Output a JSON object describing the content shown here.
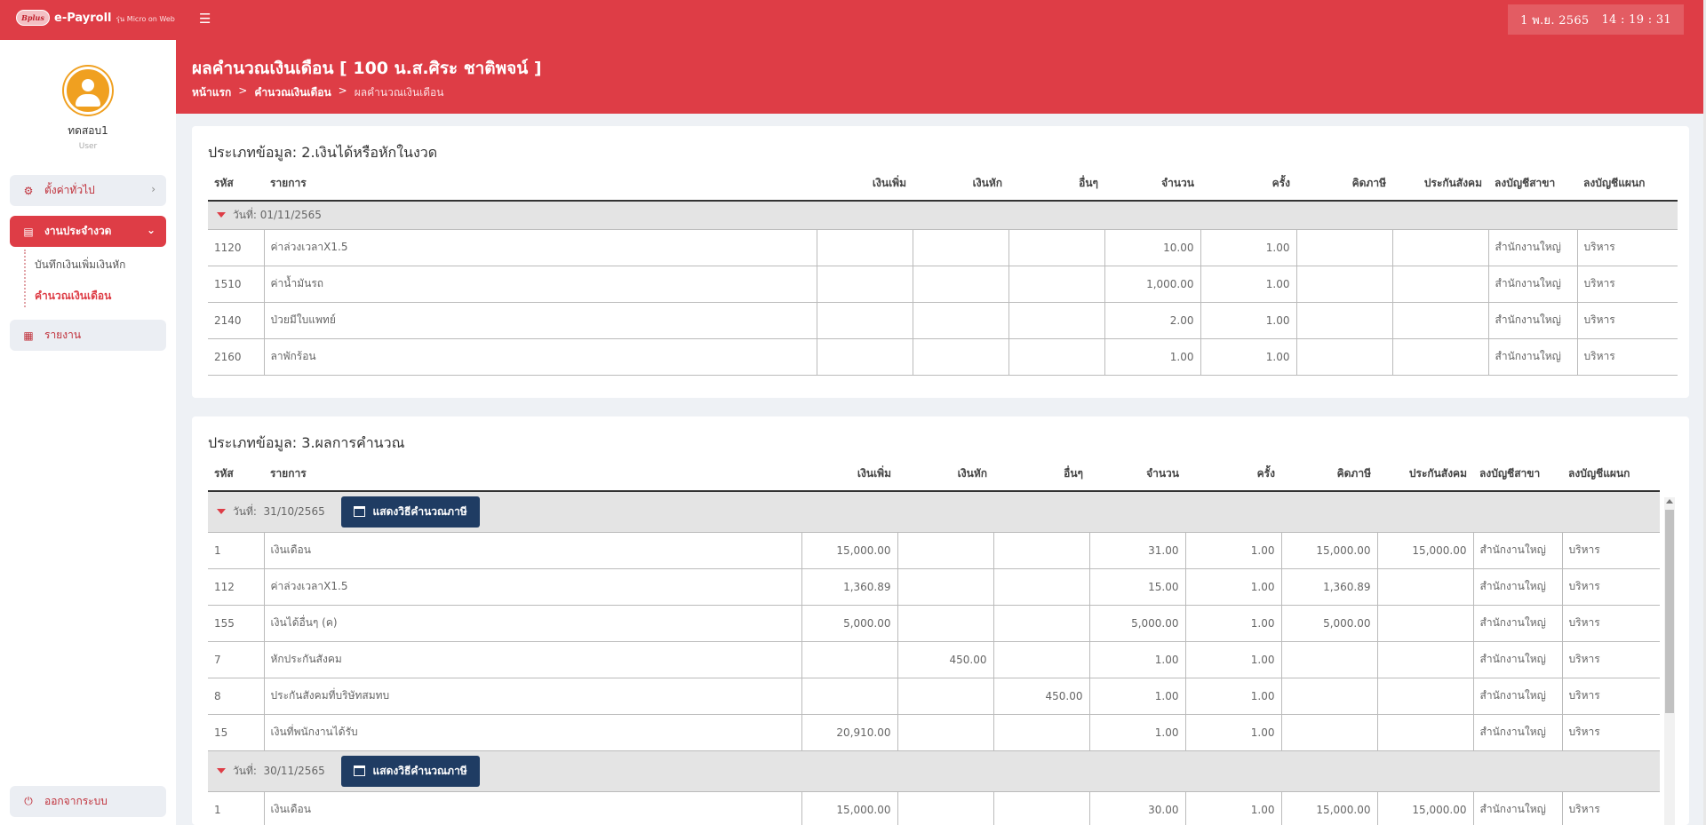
{
  "app": {
    "logo_text": "Bplus",
    "title": "e-Payroll",
    "subtitle": "รุ่น Micro on Web",
    "date": "1 พ.ย. 2565",
    "time": "14 : 19 : 31"
  },
  "user": {
    "name": "ทดสอบ1",
    "role": "User"
  },
  "sidebar": {
    "general_settings": "ตั้งค่าทั่วไป",
    "period_work": "งานประจำงวด",
    "sub_record": "บันทึกเงินเพิ่มเงินหัก",
    "sub_calculate": "คำนวณเงินเดือน",
    "reports": "รายงาน",
    "logout": "ออกจากระบบ"
  },
  "header": {
    "title": "ผลคำนวณเงินเดือน [ 100 น.ส.ศิระ ชาติพจน์ ]",
    "breadcrumb": [
      "หน้าแรก",
      ">",
      "คำนวณเงินเดือน",
      ">",
      "ผลคำนวณเงินเดือน"
    ]
  },
  "columns": [
    "รหัส",
    "รายการ",
    "เงินเพิ่ม",
    "เงินหัก",
    "อื่นๆ",
    "จำนวน",
    "ครั้ง",
    "คิดภาษี",
    "ประกันสังคม",
    "ลงบัญชีสาขา",
    "ลงบัญชีแผนก"
  ],
  "section2": {
    "title": "ประเภทข้อมูล: 2.เงินได้หรือหักในงวด",
    "date_prefix": "วันที่:",
    "date": "01/11/2565",
    "rows": [
      [
        "1120",
        "ค่าล่วงเวลาX1.5",
        "",
        "",
        "",
        "10.00",
        "1.00",
        "",
        "",
        "สำนักงานใหญ่",
        "บริหาร"
      ],
      [
        "1510",
        "ค่าน้ำมันรถ",
        "",
        "",
        "",
        "1,000.00",
        "1.00",
        "",
        "",
        "สำนักงานใหญ่",
        "บริหาร"
      ],
      [
        "2140",
        "ป่วยมีใบแพทย์",
        "",
        "",
        "",
        "2.00",
        "1.00",
        "",
        "",
        "สำนักงานใหญ่",
        "บริหาร"
      ],
      [
        "2160",
        "ลาพักร้อน",
        "",
        "",
        "",
        "1.00",
        "1.00",
        "",
        "",
        "สำนักงานใหญ่",
        "บริหาร"
      ]
    ]
  },
  "section3": {
    "title": "ประเภทข้อมูล: 3.ผลการคำนวณ",
    "tax_button": "แสดงวิธีคำนวณภาษี",
    "groups": [
      {
        "date_prefix": "วันที่:",
        "date": "31/10/2565",
        "rows": [
          [
            "1",
            "เงินเดือน",
            "15,000.00",
            "",
            "",
            "31.00",
            "1.00",
            "15,000.00",
            "15,000.00",
            "สำนักงานใหญ่",
            "บริหาร"
          ],
          [
            "112",
            "ค่าล่วงเวลาX1.5",
            "1,360.89",
            "",
            "",
            "15.00",
            "1.00",
            "1,360.89",
            "",
            "สำนักงานใหญ่",
            "บริหาร"
          ],
          [
            "155",
            "เงินได้อื่นๆ (ค)",
            "5,000.00",
            "",
            "",
            "5,000.00",
            "1.00",
            "5,000.00",
            "",
            "สำนักงานใหญ่",
            "บริหาร"
          ],
          [
            "7",
            "หักประกันสังคม",
            "",
            "450.00",
            "",
            "1.00",
            "1.00",
            "",
            "",
            "สำนักงานใหญ่",
            "บริหาร"
          ],
          [
            "8",
            "ประกันสังคมที่บริษัทสมทบ",
            "",
            "",
            "450.00",
            "1.00",
            "1.00",
            "",
            "",
            "สำนักงานใหญ่",
            "บริหาร"
          ],
          [
            "15",
            "เงินที่พนักงานได้รับ",
            "20,910.00",
            "",
            "",
            "1.00",
            "1.00",
            "",
            "",
            "สำนักงานใหญ่",
            "บริหาร"
          ]
        ]
      },
      {
        "date_prefix": "วันที่:",
        "date": "30/11/2565",
        "rows": [
          [
            "1",
            "เงินเดือน",
            "15,000.00",
            "",
            "",
            "30.00",
            "1.00",
            "15,000.00",
            "15,000.00",
            "สำนักงานใหญ่",
            "บริหาร"
          ]
        ]
      }
    ]
  },
  "colors": {
    "brand_red": "#de3d46",
    "button_navy": "#1f3c63"
  },
  "icons": [
    "hamburger-icon",
    "gear-icon",
    "book-icon",
    "report-icon",
    "logout-icon",
    "calendar-icon",
    "caret-down-icon",
    "chevron-right-icon",
    "chevron-down-icon"
  ]
}
